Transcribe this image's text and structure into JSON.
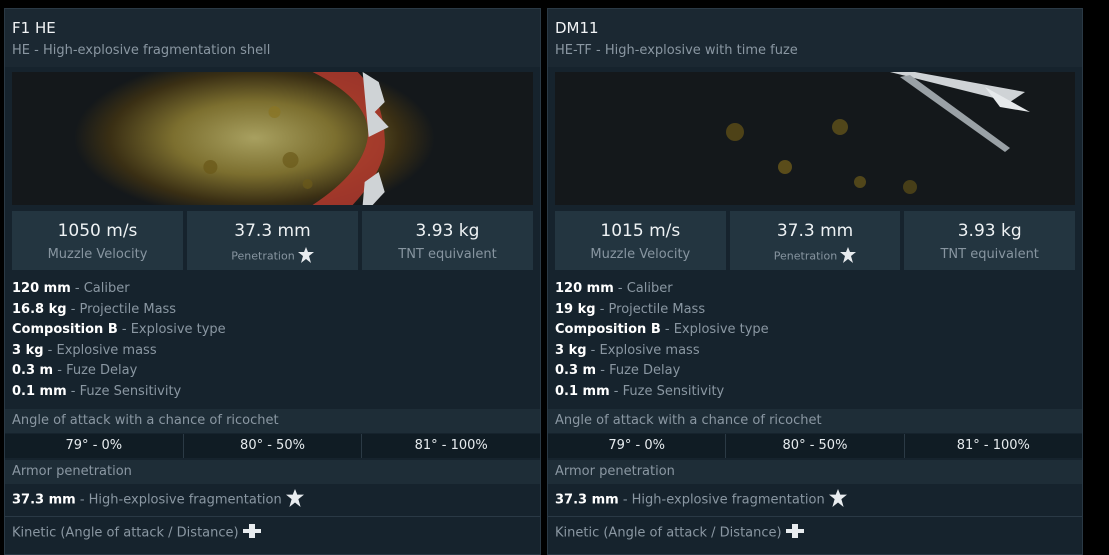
{
  "cards": [
    {
      "title": "F1 HE",
      "subtitle": "HE - High-explosive fragmentation shell",
      "stats": [
        {
          "value": "1050 m/s",
          "label": "Muzzle Velocity"
        },
        {
          "value": "37.3 mm",
          "label": "Penetration"
        },
        {
          "value": "3.93 kg",
          "label": "TNT equivalent"
        }
      ],
      "props": [
        {
          "value": "120 mm",
          "desc": " - Caliber"
        },
        {
          "value": "16.8 kg",
          "desc": " - Projectile Mass"
        },
        {
          "value": "Composition B",
          "desc": " - Explosive type"
        },
        {
          "value": "3 kg",
          "desc": " - Explosive mass"
        },
        {
          "value": "0.3 m",
          "desc": " - Fuze Delay"
        },
        {
          "value": "0.1 mm",
          "desc": " - Fuze Sensitivity"
        }
      ],
      "ricochet_header": "Angle of attack with a chance of ricochet",
      "ricochet": [
        "79° - 0%",
        "80° - 50%",
        "81° - 100%"
      ],
      "armor_header": "Armor penetration",
      "armor_value": "37.3 mm",
      "armor_desc": " - High-explosive fragmentation",
      "kinetic_label": "Kinetic (Angle of attack / Distance)"
    },
    {
      "title": "DM11",
      "subtitle": "HE-TF - High-explosive with time fuze",
      "stats": [
        {
          "value": "1015 m/s",
          "label": "Muzzle Velocity"
        },
        {
          "value": "37.3 mm",
          "label": "Penetration"
        },
        {
          "value": "3.93 kg",
          "label": "TNT equivalent"
        }
      ],
      "props": [
        {
          "value": "120 mm",
          "desc": " - Caliber"
        },
        {
          "value": "19 kg",
          "desc": " - Projectile Mass"
        },
        {
          "value": "Composition B",
          "desc": " - Explosive type"
        },
        {
          "value": "3 kg",
          "desc": " - Explosive mass"
        },
        {
          "value": "0.3 m",
          "desc": " - Fuze Delay"
        },
        {
          "value": "0.1 mm",
          "desc": " - Fuze Sensitivity"
        }
      ],
      "ricochet_header": "Angle of attack with a chance of ricochet",
      "ricochet": [
        "79° - 0%",
        "80° - 50%",
        "81° - 100%"
      ],
      "armor_header": "Armor penetration",
      "armor_value": "37.3 mm",
      "armor_desc": " - High-explosive fragmentation",
      "kinetic_label": "Kinetic (Angle of attack / Distance)"
    }
  ],
  "icons": {
    "penetration": "explosion-icon",
    "kinetic": "shell-icon"
  },
  "colors": {
    "panel": "#16232d",
    "header": "#1b2832",
    "stat_box": "#233540",
    "section": "#1e2d37",
    "muted_text": "#8a97a2"
  }
}
